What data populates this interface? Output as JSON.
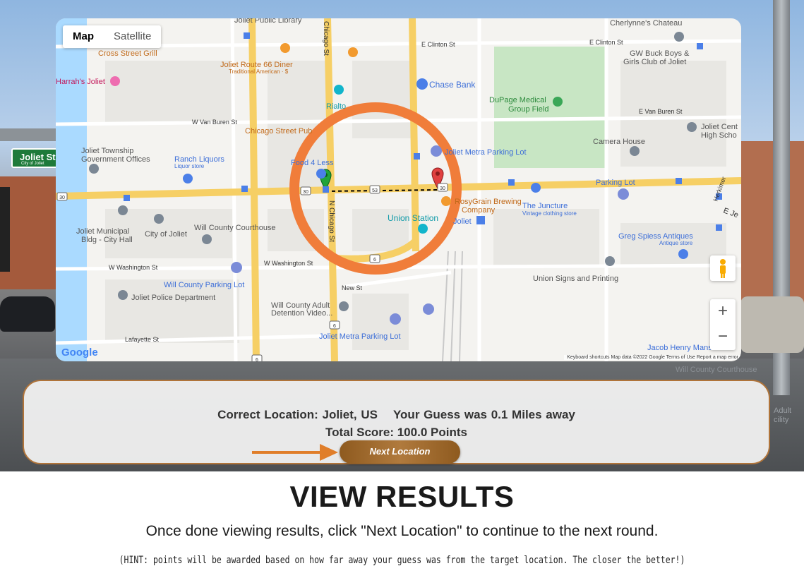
{
  "street_view": {
    "sign_text": "Joliet St",
    "sign_subtext": "City of Joliet"
  },
  "map": {
    "type_buttons": [
      "Map",
      "Satellite"
    ],
    "active_type": "Map",
    "zoom_in": "+",
    "zoom_out": "−",
    "logo": "Google",
    "attribution": "Keyboard shortcuts   Map data ©2022 Google   Terms of Use   Report a map error",
    "labels": {
      "joliet_public_library": "Joliet Public Library",
      "cherlynnes_chateau": "Cherlynne's Chateau",
      "e_clinton_st_1": "E Clinton St",
      "e_clinton_st_2": "E Clinton St",
      "cross_street_grill": "Cross Street Grill",
      "harrahs_joliet": "Harrah's Joliet",
      "joliet_route_66": "Joliet Route 66 Diner",
      "traditional_american": "Traditional American · $",
      "gw_buck_boys": "GW Buck Boys &",
      "girls_club": "Girls Club of Joliet",
      "chase_bank": "Chase Bank",
      "rialto": "Rialto",
      "dupage_medical": "DuPage Medical",
      "group_field": "Group Field",
      "w_van_buren_st": "W Van Buren St",
      "e_van_buren_st": "E Van Buren St",
      "chicago_street_pub": "Chicago Street Pub",
      "joliet_central_1": "Joliet Cent",
      "joliet_central_2": "High Scho",
      "camera_house": "Camera House",
      "joliet_township_1": "Joliet Township",
      "joliet_township_2": "Government Offices",
      "ranch_liquors": "Ranch Liquors",
      "liquor_store": "Liquor store",
      "food_4_less": "Food 4 Less",
      "joliet_metra_parking_1": "Joliet Metra Parking Lot",
      "parking_lot": "Parking Lot",
      "rosegrain_1": "RosyGrain Brewing",
      "rosegrain_2": "Company",
      "the_juncture": "The Juncture",
      "vintage_store": "Vintage clothing store",
      "union_station": "Union Station",
      "joliet_label": "Joliet",
      "joliet_municipal_1": "Joliet Municipal",
      "joliet_municipal_2": "Bldg - City Hall",
      "city_of_joliet": "City of Joliet",
      "will_county_courthouse": "Will County Courthouse",
      "greg_spiess": "Greg Spiess Antiques",
      "antique_store": "Antique store",
      "w_washington_st_1": "W Washington St",
      "w_washington_st_2": "W Washington St",
      "will_county_parking": "Will County Parking Lot",
      "union_signs": "Union Signs and Printing",
      "joliet_police": "Joliet Police Department",
      "new_st": "New St",
      "will_county_adult_1": "Will County Adult",
      "will_county_adult_2": "Detention Video...",
      "joliet_metra_parking_2": "Joliet Metra Parking Lot",
      "lafayette_st": "Lafayette St",
      "jacob_henry": "Jacob Henry Mansion",
      "chicago_st": "Chicago St",
      "n_chicago_st": "N Chicago St",
      "route_30": "30",
      "route_6": "6",
      "route_53": "53",
      "herkimer": "Herkimer",
      "e_jefferson": "E Je"
    }
  },
  "behind_map": {
    "will_county_courthouse": "Will County Courthouse",
    "adult_facility_1": "Adult",
    "adult_facility_2": "cility"
  },
  "results": {
    "correct_location": "Correct Location: Joliet, US",
    "guess_distance": "Your Guess was 0.1 Miles away",
    "total_score": "Total Score: 100.0 Points",
    "next_button": "Next Location"
  },
  "page": {
    "title": "VIEW RESULTS",
    "subtitle": "Once done viewing results, click \"Next Location\" to continue to the next round.",
    "hint": "(HINT: points will be awarded based on how far away your guess was from the target location. The closer the better!)"
  },
  "colors": {
    "highlight_circle": "#f07d3a",
    "arrow": "#e07e2a",
    "button_brown": "#a06a2e",
    "guess_pin": "#21a33a",
    "target_pin": "#e04040",
    "major_road": "#f6cf65"
  },
  "icons": [
    "arrow-right-icon",
    "pegman-icon",
    "guess-pin-icon",
    "target-pin-icon",
    "parking-icon",
    "bus-stop-icon",
    "restaurant-icon",
    "bank-icon",
    "hospital-icon",
    "landmark-icon",
    "shopping-icon"
  ]
}
